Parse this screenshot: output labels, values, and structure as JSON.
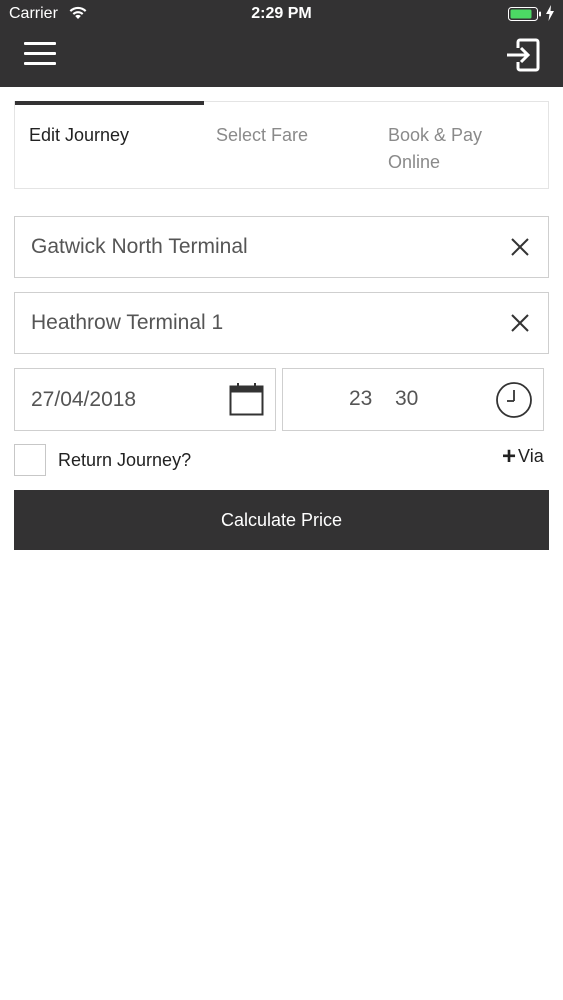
{
  "status_bar": {
    "carrier": "Carrier",
    "time": "2:29 PM",
    "battery_color": "#4cd964"
  },
  "header": {
    "menu_icon": "hamburger-menu-icon",
    "logout_icon": "logout-icon"
  },
  "steps": [
    {
      "label": "Edit Journey",
      "active": true
    },
    {
      "label": "Select Fare",
      "active": false
    },
    {
      "label": "Book & Pay Online",
      "active": false
    }
  ],
  "journey": {
    "from_value": "Gatwick North Terminal",
    "to_value": "Heathrow Terminal 1",
    "date_value": "27/04/2018",
    "time_hour": "23",
    "time_minute": "30",
    "return_label": "Return Journey?",
    "return_checked": false,
    "via_label": "Via"
  },
  "actions": {
    "calculate_label": "Calculate Price"
  },
  "colors": {
    "dark": "#333233",
    "muted_text": "#8a8a8a",
    "border": "#cfcfcf"
  }
}
